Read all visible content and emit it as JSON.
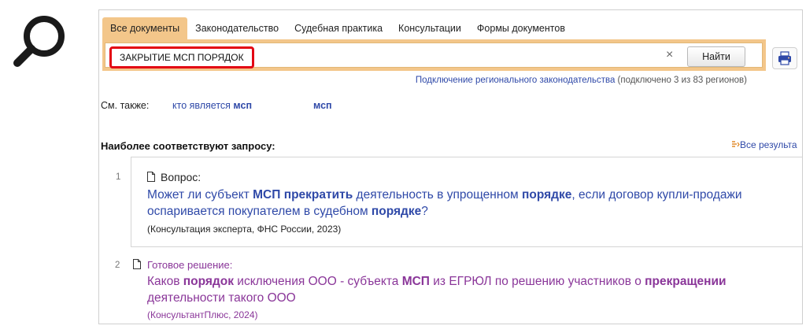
{
  "icons": {
    "magnifier": "magnifier-icon",
    "print": "print-icon",
    "document": "document-icon",
    "all_results": "list-arrow-icon"
  },
  "tabs": [
    "Все документы",
    "Законодательство",
    "Судебная практика",
    "Консультации",
    "Формы документов"
  ],
  "search": {
    "query": "ЗАКРЫТИЕ МСП ПОРЯДОК",
    "clear": "×",
    "button": "Найти"
  },
  "regional": {
    "link": "Подключение регионального законодательства",
    "status": "(подключено 3 из 83 регионов)"
  },
  "see_also": {
    "label": "См. также:",
    "s1_pre": "кто является ",
    "s1_bold": "мсп",
    "s2_bold": "мсп"
  },
  "results_header": {
    "title": "Наиболее соответствуют запросу:",
    "all": "Все результа"
  },
  "results": [
    {
      "num": "1",
      "type": "Вопрос:",
      "title": [
        {
          "t": "Может ли субъект ",
          "b": false
        },
        {
          "t": "МСП",
          "b": true
        },
        {
          "t": " ",
          "b": false
        },
        {
          "t": "прекратить",
          "b": true
        },
        {
          "t": " деятельность в упрощенном ",
          "b": false
        },
        {
          "t": "порядке",
          "b": true
        },
        {
          "t": ", если договор купли-продажи оспаривается покупателем в судебном ",
          "b": false
        },
        {
          "t": "порядке",
          "b": true
        },
        {
          "t": "?",
          "b": false
        }
      ],
      "source": "(Консультация эксперта, ФНС России, 2023)"
    },
    {
      "num": "2",
      "type": "Готовое решение:",
      "title": [
        {
          "t": "Каков ",
          "b": false
        },
        {
          "t": "порядок",
          "b": true
        },
        {
          "t": " исключения ООО - субъекта ",
          "b": false
        },
        {
          "t": "МСП",
          "b": true
        },
        {
          "t": " из ЕГРЮЛ по решению участников о ",
          "b": false
        },
        {
          "t": "прекращении",
          "b": true
        },
        {
          "t": " деятельности такого ООО",
          "b": false
        }
      ],
      "source": "(КонсультантПлюс, 2024)"
    }
  ],
  "colors": {
    "accent": "#f3c68a",
    "highlight_border": "#e30613",
    "link": "#2f49a8",
    "visited": "#8a3699"
  }
}
